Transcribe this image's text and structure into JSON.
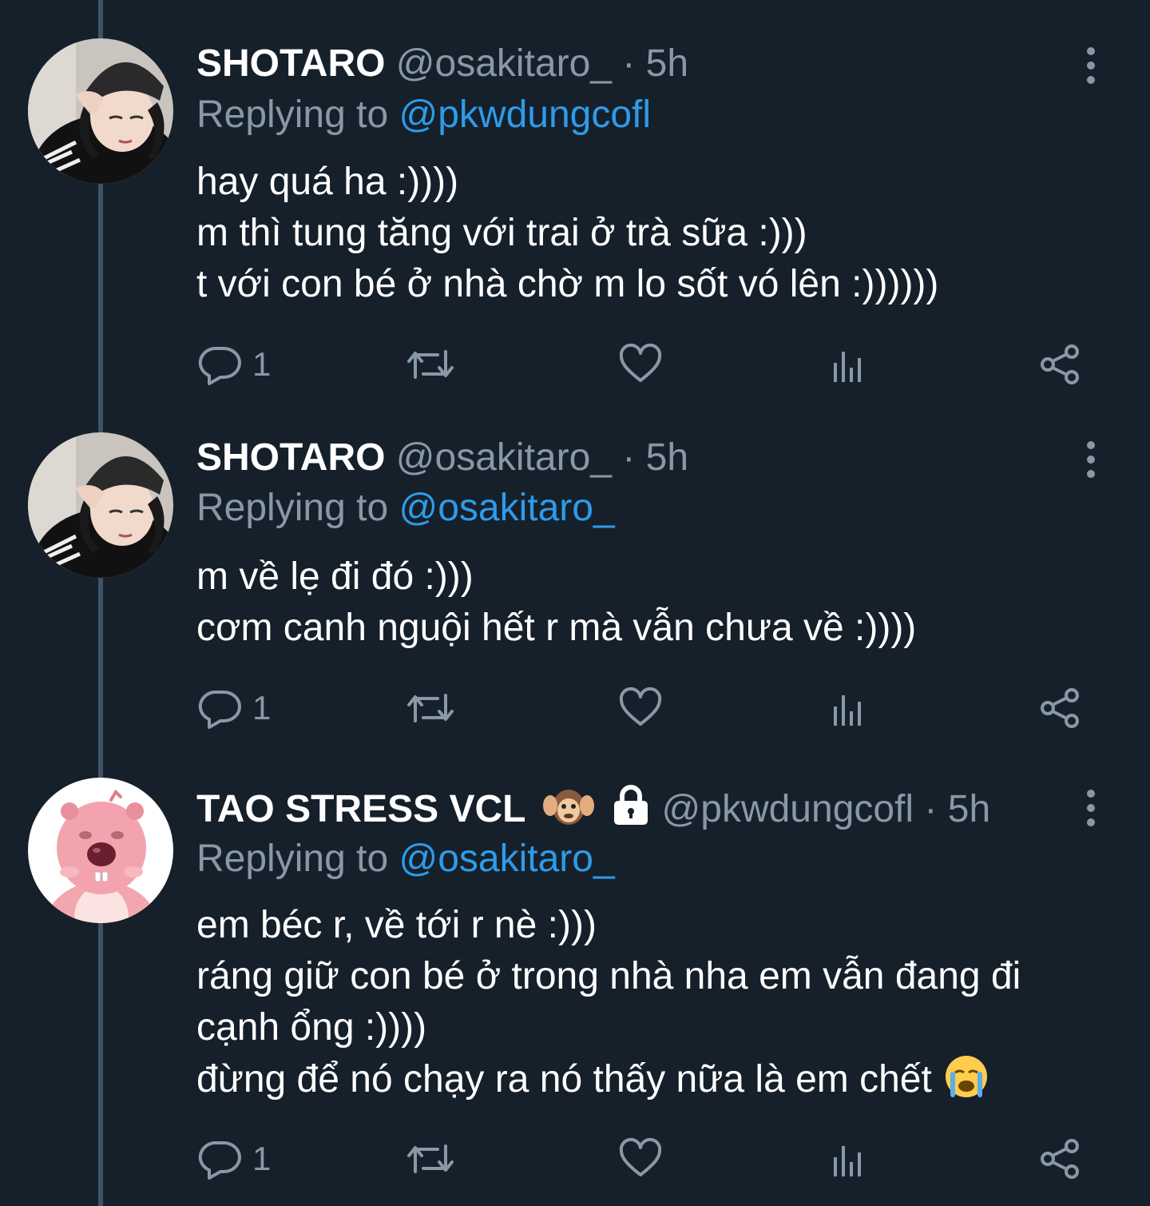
{
  "thread": {
    "tweets": [
      {
        "author_name": "SHOTARO",
        "handle": "@osakitaro_",
        "separator": "·",
        "time": "5h",
        "reply_prefix": "Replying to",
        "reply_to": "@pkwdungcofl",
        "lines": [
          "hay quá ha :))))",
          "m thì tung tăng với trai ở trà sữa :)))",
          "t với con bé ở nhà chờ m lo sốt vó lên :))))))"
        ],
        "reply_count": "1",
        "avatar": "person-avatar"
      },
      {
        "author_name": "SHOTARO",
        "handle": "@osakitaro_",
        "separator": "·",
        "time": "5h",
        "reply_prefix": "Replying to",
        "reply_to": "@osakitaro_",
        "lines": [
          "m về lẹ đi đó :)))",
          "cơm canh nguội hết r mà vẫn chưa về :))))"
        ],
        "reply_count": "1",
        "avatar": "person-avatar"
      },
      {
        "author_name": "TAO STRESS VCL",
        "name_emojis": [
          "hear-no-evil-monkey-icon",
          "lock-icon"
        ],
        "handle": "@pkwdungcofl",
        "separator": "·",
        "time": "5h",
        "reply_prefix": "Replying to",
        "reply_to": "@osakitaro_",
        "lines": [
          "em béc r, về tới r nè :)))",
          "ráng giữ con bé ở trong nhà nha em vẫn đang đi",
          "cạnh ổng :))))",
          "đừng để nó chạy ra nó thấy nữa là em chết"
        ],
        "trailing_emoji": "crying-face-icon",
        "reply_count": "1",
        "avatar": "pink-beaver-avatar"
      }
    ],
    "action_icons": [
      "reply-icon",
      "retweet-icon",
      "like-icon",
      "analytics-icon",
      "share-icon"
    ]
  },
  "colors": {
    "background": "#15202b",
    "text": "#ffffff",
    "secondary": "#8899a6",
    "mention": "#2f9be8",
    "thread_line": "#3d5466"
  }
}
